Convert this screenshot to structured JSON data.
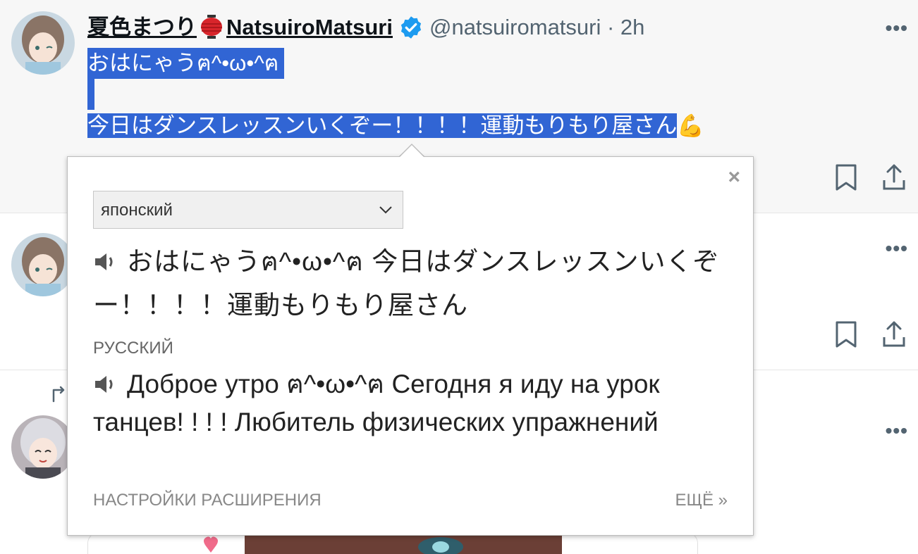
{
  "tweet1": {
    "display_name_jp": "夏色まつり",
    "display_name_en": "NatsuiroMatsuri",
    "handle": "@natsuiromatsuri",
    "time": "· 2h",
    "line1": "おはにゃうฅ^•ω•^ฅ",
    "line2": "今日はダンスレッスンいくぞー！！！！運動もりもり屋さん",
    "emoji": "💪"
  },
  "more_label": "•••",
  "popup": {
    "close": "×",
    "source_lang": "японский",
    "source_text": "おはにゃうฅ^•ω•^ฅ 今日はダンスレッスンいくぞー！！！！運動もりもり屋さん",
    "target_lang": "РУССКИЙ",
    "target_text": "Доброе утро ฅ^•ω•^ฅ Сегодня я иду на урок танцев! ! ! ! Любитель физических упражнений",
    "settings_link": "НАСТРОЙКИ РАСШИРЕНИЯ",
    "more_link": "ЕЩЁ »"
  },
  "colors": {
    "selection": "#3165d4",
    "verified": "#1d9bf0",
    "muted": "#536471"
  },
  "icons": [
    "verified-badge-icon",
    "lantern-icon",
    "bookmark-icon",
    "share-icon",
    "speaker-icon",
    "chevron-down-icon",
    "retweet-icon",
    "more-icon"
  ]
}
